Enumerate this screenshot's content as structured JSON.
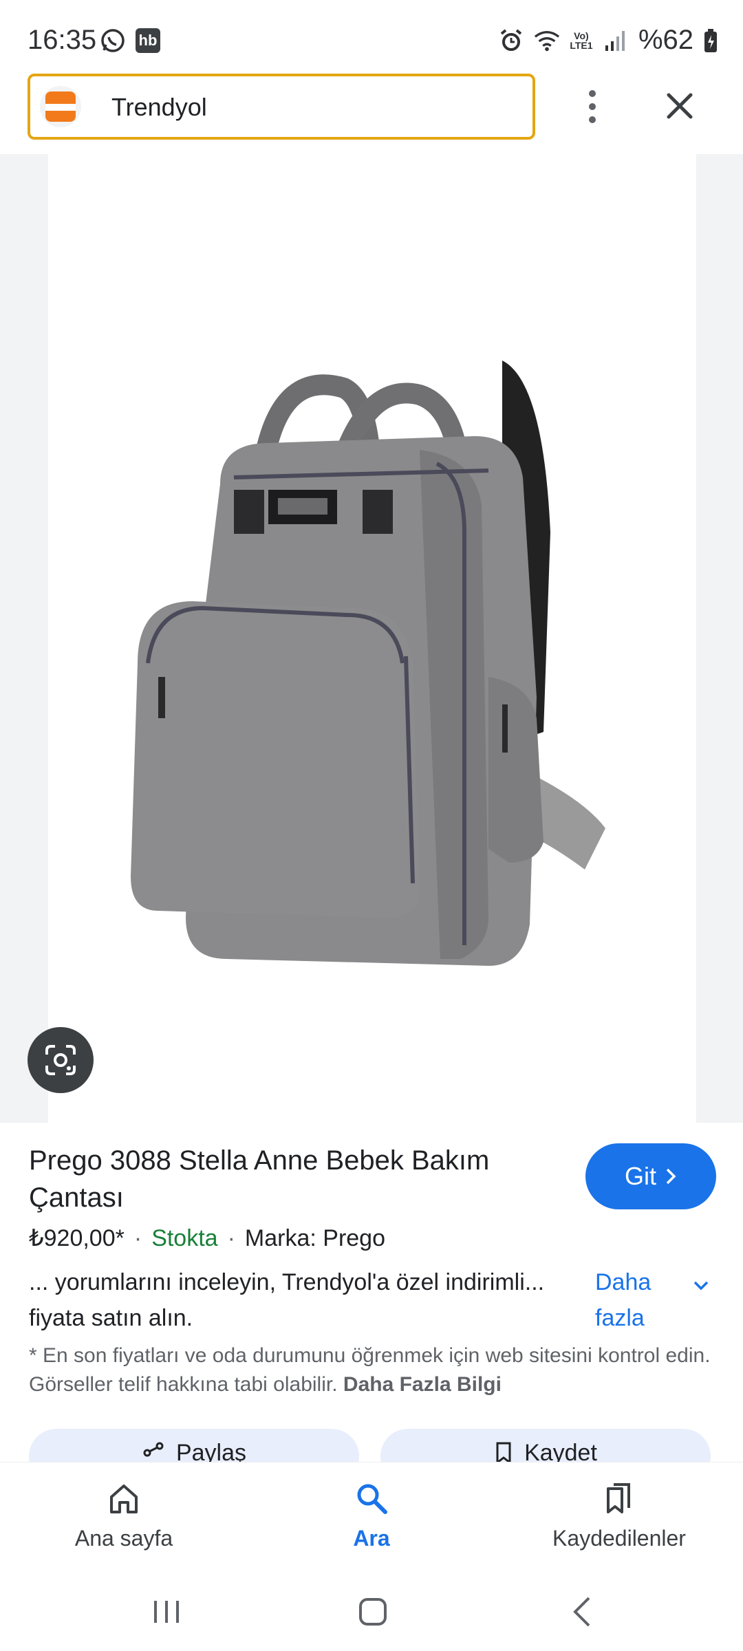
{
  "status_bar": {
    "time": "16:35",
    "battery": "%62",
    "notification_icons": [
      "whatsapp-icon",
      "hb-icon"
    ],
    "system_icons": [
      "alarm-icon",
      "wifi-icon",
      "volte-icon",
      "signal-icon",
      "battery-icon"
    ],
    "hb_label": "hb",
    "volte_label": "Vo) LTE1"
  },
  "address_bar": {
    "site_name": "Trendyol"
  },
  "product": {
    "title": "Prego 3088 Stella Anne Bebek Bakım Çantası",
    "go_button": "Git",
    "price": "₺920,00*",
    "stock": "Stokta",
    "brand": "Marka: Prego",
    "separator": "·",
    "description": "... yorumlarını inceleyin, Trendyol'a özel indirimli... fiyata satın alın.",
    "more_label": "Daha fazla",
    "disclaimer": "* En son fiyatları ve oda durumunu öğrenmek için web sitesini kontrol edin. Görseller telif hakkına tabi olabilir.",
    "disclaimer_link": "Daha Fazla Bilgi"
  },
  "actions": {
    "share": "Paylaş",
    "save": "Kaydet"
  },
  "bottom_nav": {
    "items": [
      {
        "label": "Ana sayfa",
        "icon": "home-icon",
        "active": false
      },
      {
        "label": "Ara",
        "icon": "search-icon",
        "active": true
      },
      {
        "label": "Kaydedilenler",
        "icon": "bookmarks-icon",
        "active": false
      }
    ]
  },
  "colors": {
    "accent": "#1a73e8",
    "stock_green": "#188038",
    "address_border": "#e3a613",
    "brand_orange": "#f27a1a"
  }
}
